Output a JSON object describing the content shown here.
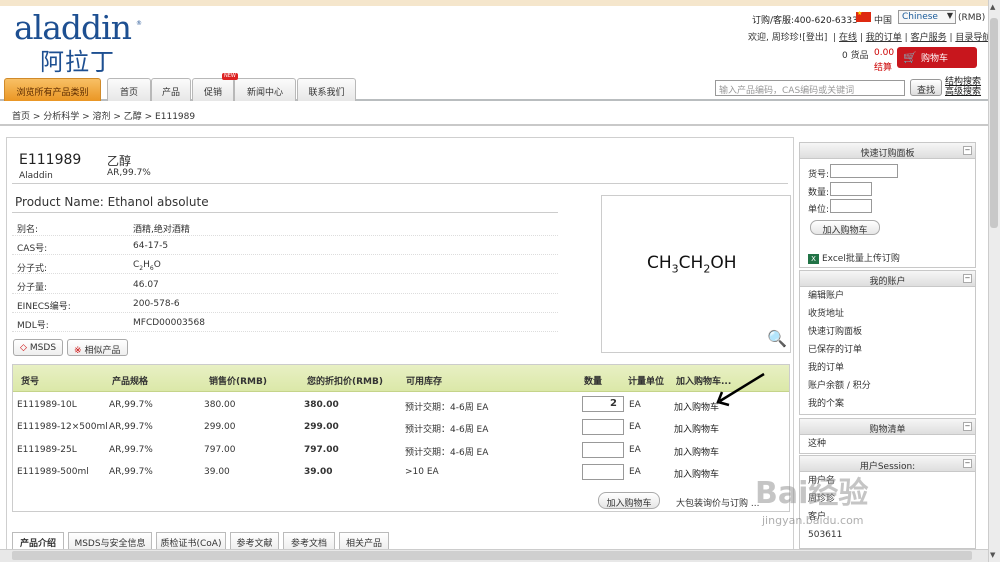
{
  "logo": {
    "latin": "aladdin",
    "cn": "阿拉丁",
    "tm": "®"
  },
  "top": {
    "hotline": "订购/客服:400-620-6333",
    "country": "中国",
    "language": "Chinese",
    "currency": "(RMB)",
    "greeting": "欢迎, 周珍珍!",
    "logout": "[登出]",
    "links": [
      "在线",
      "我的订单",
      "客户服务",
      "目录导航"
    ],
    "cart_count": "0 货品",
    "cart_amount": "0.00",
    "checkout": "结算",
    "cart_button": "购物车"
  },
  "nav": {
    "tabs": [
      "浏览所有产品类别",
      "首页",
      "产品",
      "促销",
      "新闻中心",
      "联系我们"
    ],
    "new_badge": "NEW",
    "search_placeholder": "输入产品编码，CAS编码或关键词",
    "search_button": "查找",
    "adv_links": [
      "结构搜索",
      "高级搜索"
    ]
  },
  "breadcrumb": "首页 > 分析科学 > 溶剂 > 乙醇 > E111989",
  "product": {
    "sku": "E111989",
    "brand": "Aladdin",
    "cn_name": "乙醇",
    "grade": "AR,99.7%",
    "name_line": "Product Name: Ethanol absolute",
    "attributes": [
      {
        "label": "别名:",
        "value": "酒精,绝对酒精"
      },
      {
        "label": "CAS号:",
        "value": "64-17-5"
      },
      {
        "label": "分子式:",
        "value": "C2H6O"
      },
      {
        "label": "分子量:",
        "value": "46.07"
      },
      {
        "label": "EINECS编号:",
        "value": "200-578-6"
      },
      {
        "label": "MDL号:",
        "value": "MFCD00003568"
      }
    ],
    "msds_button": "MSDS",
    "related_button": "相似产品",
    "formula": {
      "p1": "CH",
      "s1": "3",
      "p2": "CH",
      "s2": "2",
      "p3": "OH"
    }
  },
  "table": {
    "headers": [
      "货号",
      "产品规格",
      "销售价(RMB)",
      "您的折扣价(RMB)",
      "可用库存",
      "数量",
      "计量单位",
      "加入购物车..."
    ],
    "rows": [
      {
        "code": "E111989-10L",
        "spec": "AR,99.7%",
        "price": "380.00",
        "discount": "380.00",
        "stock": "预计交期：4-6周 EA",
        "qty": "2",
        "unit": "EA",
        "add": "加入购物车"
      },
      {
        "code": "E111989-12×500ml",
        "spec": "AR,99.7%",
        "price": "299.00",
        "discount": "299.00",
        "stock": "预计交期：4-6周 EA",
        "qty": "",
        "unit": "EA",
        "add": "加入购物车"
      },
      {
        "code": "E111989-25L",
        "spec": "AR,99.7%",
        "price": "797.00",
        "discount": "797.00",
        "stock": "预计交期：4-6周 EA",
        "qty": "",
        "unit": "EA",
        "add": "加入购物车"
      },
      {
        "code": "E111989-500ml",
        "spec": "AR,99.7%",
        "price": "39.00",
        "discount": "39.00",
        "stock": ">10 EA",
        "qty": "",
        "unit": "EA",
        "add": "加入购物车"
      }
    ],
    "add_cart_button": "加入购物车",
    "bulk_link": "大包装询价与订购 ..."
  },
  "bottom_tabs": [
    "产品介绍",
    "MSDS与安全信息",
    "质检证书(CoA)",
    "参考文献",
    "参考文档",
    "相关产品"
  ],
  "sidebar": {
    "quick_order": {
      "title": "快速订购面板",
      "labels": [
        "货号:",
        "数量:",
        "单位:"
      ],
      "button": "加入购物车",
      "excel": "Excel批量上传订购"
    },
    "account": {
      "title": "我的账户",
      "items": [
        "编辑账户",
        "收货地址",
        "快速订购面板",
        "已保存的订单",
        "我的订单",
        "账户余额 / 积分",
        "我的个案"
      ]
    },
    "shopping_list": {
      "title": "购物清单",
      "items": [
        "这种"
      ]
    },
    "session": {
      "title": "用户Session:",
      "items": [
        "用户名",
        "周珍珍",
        "客户",
        "503611"
      ]
    }
  },
  "watermark": {
    "text": "Bai经验",
    "url": "jingyan.baidu.com"
  }
}
